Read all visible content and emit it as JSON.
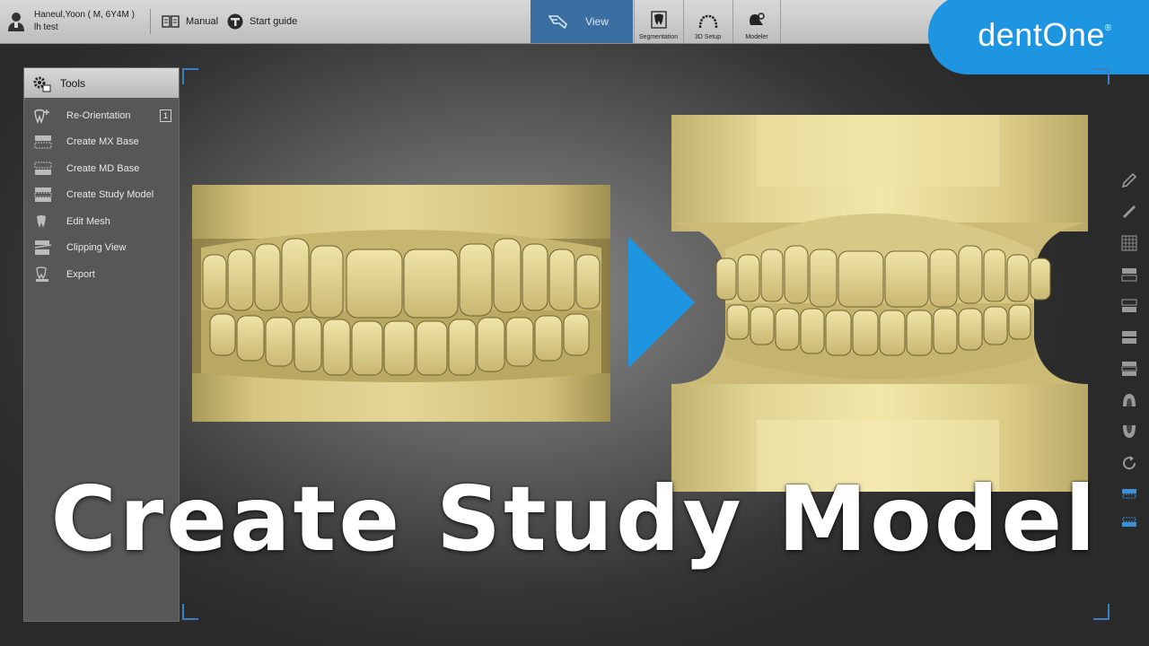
{
  "patient": {
    "name_line": "Haneul,Yoon ( M, 6Y4M )",
    "note": "lh test"
  },
  "topbar": {
    "manual_label": "Manual",
    "start_guide_label": "Start guide"
  },
  "modes": [
    {
      "label": "View",
      "active": true
    },
    {
      "label": "Segmentation",
      "active": false
    },
    {
      "label": "3D Setup",
      "active": false
    },
    {
      "label": "Modeler",
      "active": false
    }
  ],
  "brand": {
    "logo_text": "dentOne",
    "registered": "®",
    "color": "#1e95e0"
  },
  "tools": {
    "title": "Tools",
    "items": [
      {
        "label": "Re-Orientation",
        "shortcut": "1",
        "icon": "tooth-reorient-icon"
      },
      {
        "label": "Create MX Base",
        "icon": "mx-base-icon"
      },
      {
        "label": "Create MD Base",
        "icon": "md-base-icon"
      },
      {
        "label": "Create Study Model",
        "icon": "study-model-icon"
      },
      {
        "label": "Edit Mesh",
        "icon": "edit-mesh-icon"
      },
      {
        "label": "Clipping View",
        "icon": "clipping-view-icon"
      },
      {
        "label": "Export",
        "icon": "export-icon"
      }
    ]
  },
  "right_toolbar": [
    "pencil-icon",
    "ruler-icon",
    "grid-icon",
    "upper-arch-icon",
    "lower-arch-icon",
    "both-arches-icon",
    "split-arches-icon",
    "occlusal-upper-icon",
    "occlusal-lower-icon",
    "rotate-icon",
    "upper-base-active-icon",
    "lower-base-active-icon"
  ],
  "caption": "Create Study Model",
  "colors": {
    "active_mode": "#3b6ea0",
    "accent_blue": "#1e95e0",
    "model_gold": "#d8c885"
  }
}
